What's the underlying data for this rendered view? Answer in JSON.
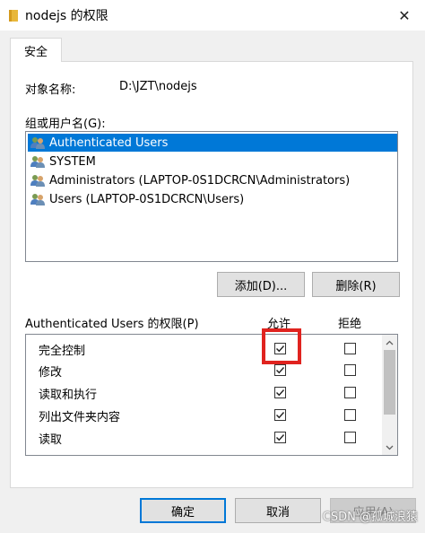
{
  "window": {
    "title": "nodejs 的权限",
    "close_glyph": "✕"
  },
  "tab": {
    "label": "安全"
  },
  "object": {
    "label": "对象名称:",
    "value": "D:\\JZT\\nodejs"
  },
  "groups": {
    "label": "组或用户名(G):",
    "items": [
      {
        "label": "Authenticated Users",
        "selected": true
      },
      {
        "label": "SYSTEM",
        "selected": false
      },
      {
        "label": "Administrators (LAPTOP-0S1DCRCN\\Administrators)",
        "selected": false
      },
      {
        "label": "Users (LAPTOP-0S1DCRCN\\Users)",
        "selected": false
      }
    ]
  },
  "buttons": {
    "add": "添加(D)...",
    "remove": "删除(R)",
    "ok": "确定",
    "cancel": "取消",
    "apply": "应用(A)"
  },
  "permissions": {
    "label": "Authenticated Users 的权限(P)",
    "allow_header": "允许",
    "deny_header": "拒绝",
    "rows": [
      {
        "name": "完全控制",
        "allow": true,
        "deny": false
      },
      {
        "name": "修改",
        "allow": true,
        "deny": false
      },
      {
        "name": "读取和执行",
        "allow": true,
        "deny": false
      },
      {
        "name": "列出文件夹内容",
        "allow": true,
        "deny": false
      },
      {
        "name": "读取",
        "allow": true,
        "deny": false
      }
    ]
  },
  "watermark": "CSDN @孤城浪猿",
  "colors": {
    "selection": "#0078d7",
    "highlight": "#e0231f"
  }
}
